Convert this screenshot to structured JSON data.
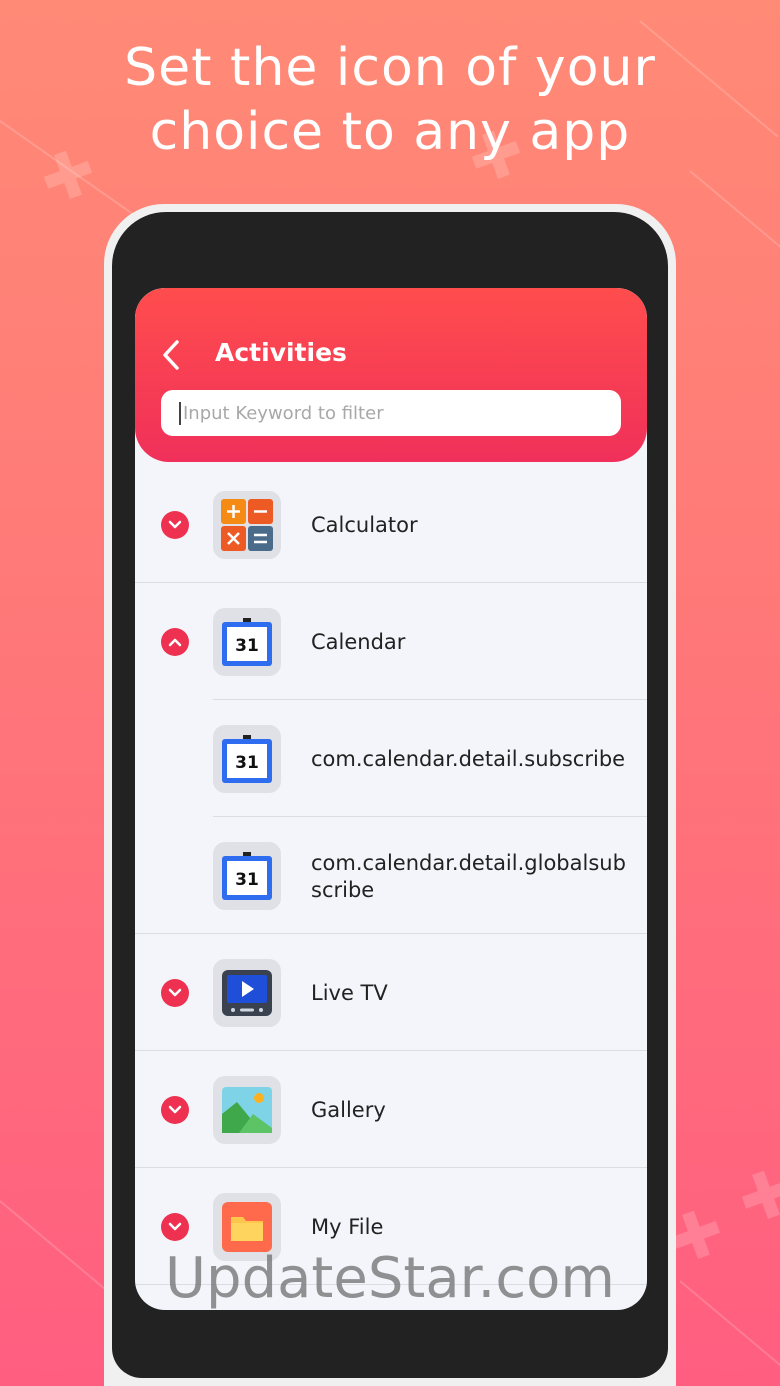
{
  "headline": {
    "line1": "Set the icon of your",
    "line2": "choice to any app"
  },
  "appbar": {
    "title": "Activities",
    "search_placeholder": "Input Keyword to filter"
  },
  "activities": [
    {
      "label": "Calculator",
      "icon": "calculator-icon",
      "expanded": false
    },
    {
      "label": "Calendar",
      "icon": "calendar-icon",
      "expanded": true
    },
    {
      "label": "com.calendar.detail.subscribe",
      "icon": "calendar-icon",
      "sub": true
    },
    {
      "label": "com.calendar.detail.globalsubscribe",
      "icon": "calendar-icon",
      "sub": true
    },
    {
      "label": "Live TV",
      "icon": "tv-icon",
      "expanded": false
    },
    {
      "label": "Gallery",
      "icon": "gallery-icon",
      "expanded": false
    },
    {
      "label": "My File",
      "icon": "folder-icon",
      "expanded": false
    }
  ],
  "calendar_day": "31",
  "watermark": "UpdateStar.com",
  "colors": {
    "accent": "#ee3150",
    "background": "#ff7a78"
  }
}
